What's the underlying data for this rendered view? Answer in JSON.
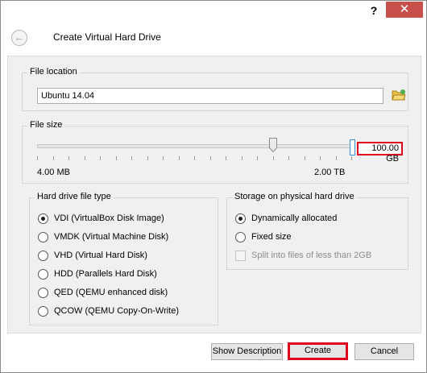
{
  "window": {
    "help_label": "?",
    "close_label": "✕",
    "title": "Create Virtual Hard Drive"
  },
  "file_location": {
    "group_label": "File location",
    "value": "Ubuntu 14.04",
    "browse_icon": "folder-open-icon"
  },
  "file_size": {
    "group_label": "File size",
    "min_label": "4.00 MB",
    "max_label": "2.00 TB",
    "value": "100.00 GB",
    "slider_fraction": 0.75
  },
  "file_type": {
    "group_label": "Hard drive file type",
    "options": [
      {
        "label": "VDI (VirtualBox Disk Image)",
        "selected": true
      },
      {
        "label": "VMDK (Virtual Machine Disk)",
        "selected": false
      },
      {
        "label": "VHD (Virtual Hard Disk)",
        "selected": false
      },
      {
        "label": "HDD (Parallels Hard Disk)",
        "selected": false
      },
      {
        "label": "QED (QEMU enhanced disk)",
        "selected": false
      },
      {
        "label": "QCOW (QEMU Copy-On-Write)",
        "selected": false
      }
    ]
  },
  "storage": {
    "group_label": "Storage on physical hard drive",
    "options": [
      {
        "label": "Dynamically allocated",
        "selected": true
      },
      {
        "label": "Fixed size",
        "selected": false
      }
    ],
    "split_label": "Split into files of less than 2GB"
  },
  "buttons": {
    "show_description": "Show Description",
    "create": "Create",
    "cancel": "Cancel"
  },
  "colors": {
    "highlight": "#e0001b",
    "close_button": "#c7504a"
  }
}
